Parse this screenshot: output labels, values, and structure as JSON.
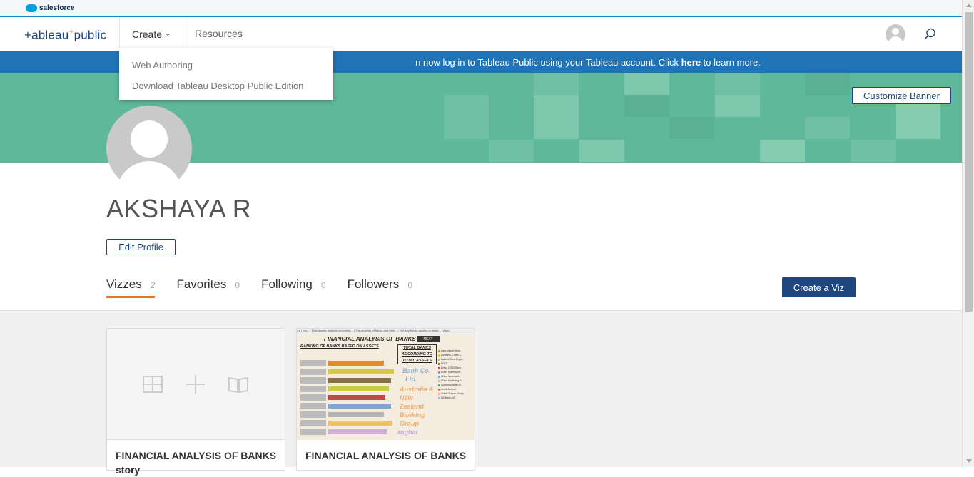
{
  "salesforce_bar": {
    "brand": "salesforce"
  },
  "topnav": {
    "logo_text": "+ableau",
    "logo_plus": "+",
    "logo_suffix": "public",
    "create_label": "Create",
    "resources_label": "Resources"
  },
  "create_dropdown": {
    "items": [
      "Web Authoring",
      "Download Tableau Desktop Public Edition"
    ]
  },
  "info_bar": {
    "text_before": "n now log in to Tableau Public using your Tableau account. Click ",
    "link": "here",
    "text_after": " to learn more."
  },
  "banner": {
    "customize_label": "Customize Banner"
  },
  "profile": {
    "name": "AKSHAYA R",
    "edit_label": "Edit Profile"
  },
  "tabs": [
    {
      "label": "Vizzes",
      "count": "2"
    },
    {
      "label": "Favorites",
      "count": "0"
    },
    {
      "label": "Following",
      "count": "0"
    },
    {
      "label": "Followers",
      "count": "0"
    }
  ],
  "create_viz_label": "Create a Viz",
  "cards": [
    {
      "title": "FINANCIAL ANALYSIS OF BANKS",
      "title_line2": "story"
    },
    {
      "title": "FINANCIAL ANALYSIS OF BANKS"
    }
  ],
  "thumbnail": {
    "tabs_text": "◂ ▸ | Ins...  | Total assets analysis according...  | The analysis of banks and their...  | The key banks assets on asset...  | Asso",
    "title": "FINANCIAL ANALYSIS OF BANKS",
    "next": "NEXT",
    "subtitle": "RANKING OF BANKS BASED ON ASSETS",
    "total_box": "TOTAL BANKS ACCORDING TO TOTAL ASSETS",
    "overlay_words": [
      "Bank Co.",
      "Ltd",
      "Australia &",
      "New",
      "Zealand",
      "Banking",
      "Group",
      "anghai"
    ],
    "legend": [
      "Agricultural Deve..",
      "Australia & New Z..",
      "Bank of New Engla..",
      "BPCE",
      "China CITIC Bank ..",
      "China Everbright ..",
      "China Merchant..",
      "China Minsheng B..",
      "Commonwealth B..",
      "Credit Mutuel",
      "Credit Suisse Group",
      "DZ Bank AG"
    ],
    "legend_colors": [
      "#e08c2c",
      "#d8c84a",
      "#b5b5b5",
      "#8a6e4b",
      "#c04848",
      "#a38bc4",
      "#7fa8d0",
      "#d4b0d8",
      "#6da56d",
      "#e07a5f",
      "#f0c070",
      "#c8a8e0"
    ]
  },
  "colors": {
    "brand_navy": "#1f457e",
    "accent_orange": "#e97627",
    "info_blue": "#1f73b7",
    "banner_green": "#5fb89a"
  }
}
